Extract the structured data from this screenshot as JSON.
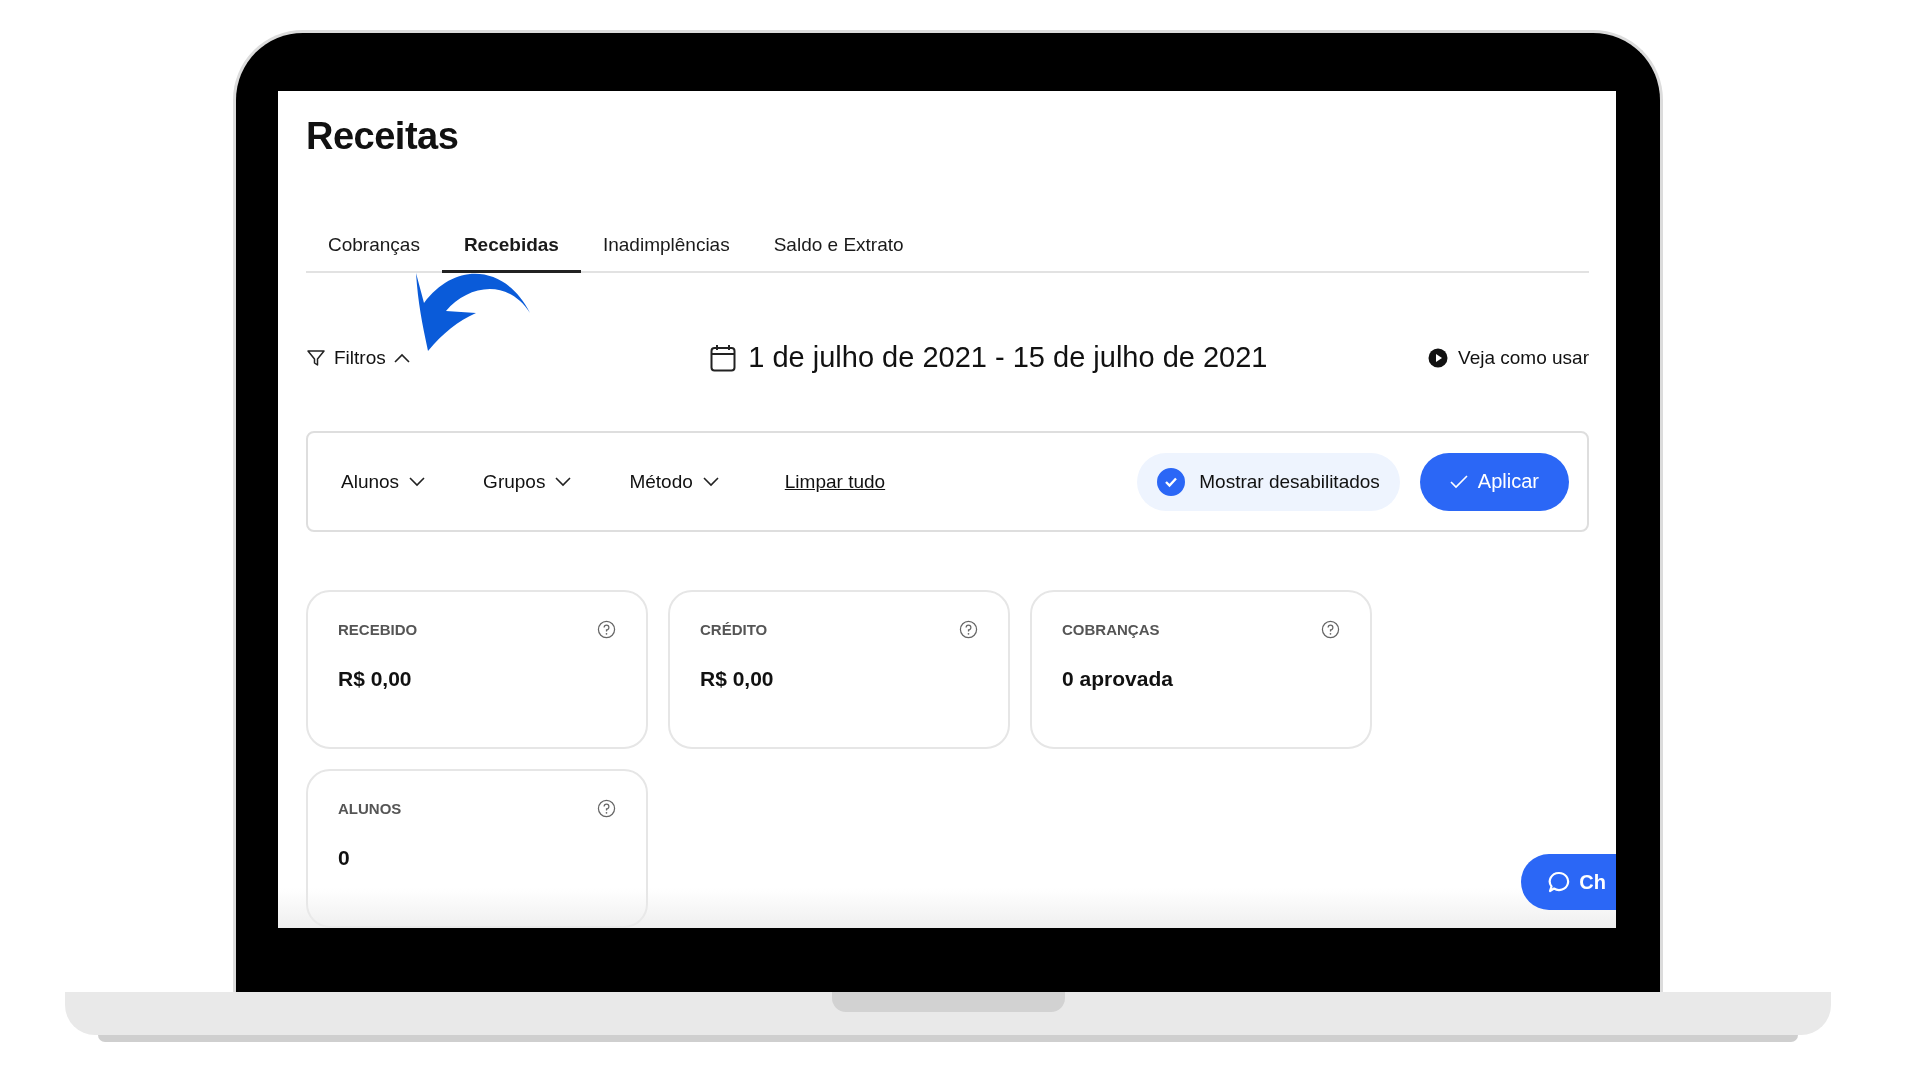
{
  "page": {
    "title": "Receitas"
  },
  "tabs": [
    {
      "label": "Cobranças",
      "selected": false
    },
    {
      "label": "Recebidas",
      "selected": true
    },
    {
      "label": "Inadimplências",
      "selected": false
    },
    {
      "label": "Saldo e Extrato",
      "selected": false
    }
  ],
  "filters_toggle": {
    "label": "Filtros",
    "expanded": true
  },
  "date_range": "1 de julho de 2021 - 15 de julho de 2021",
  "help_link": "Veja como usar",
  "filter_panel": {
    "dropdowns": [
      "Alunos",
      "Grupos",
      "Método"
    ],
    "clear_link": "Limpar tudo",
    "show_disabled": {
      "label": "Mostrar desabilitados",
      "checked": true
    },
    "apply_button": "Aplicar"
  },
  "cards": [
    {
      "label": "RECEBIDO",
      "value": "R$ 0,00"
    },
    {
      "label": "CRÉDITO",
      "value": "R$ 0,00"
    },
    {
      "label": "COBRANÇAS",
      "value": "0 aprovada"
    },
    {
      "label": "ALUNOS",
      "value": "0"
    }
  ],
  "chat_button": "Ch"
}
